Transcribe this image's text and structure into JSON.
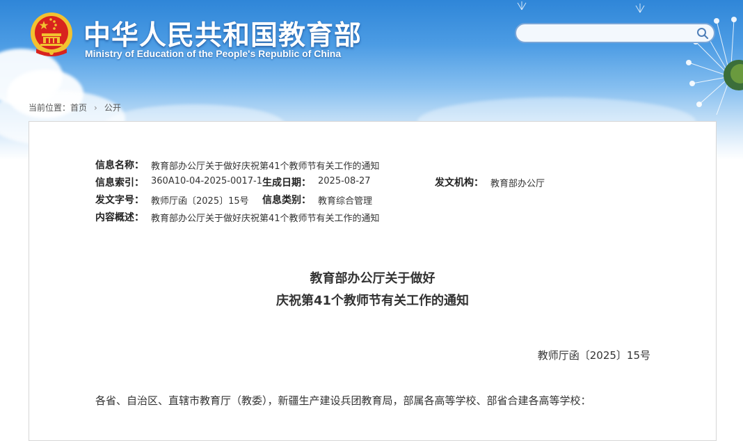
{
  "header": {
    "title": "中华人民共和国教育部",
    "subtitle": "Ministry of Education of the People's Republic of China",
    "emblem_icon": "national-emblem-icon"
  },
  "search": {
    "value": "",
    "placeholder": "",
    "button_icon": "search-icon"
  },
  "breadcrumb": {
    "prefix": "当前位置：",
    "items": [
      "首页",
      "公开"
    ],
    "separator": "›"
  },
  "meta": {
    "info_name_label": "信息名称：",
    "info_name_value": "教育部办公厅关于做好庆祝第41个教师节有关工作的通知",
    "index_label": "信息索引：",
    "index_value": "360A10-04-2025-0017-1",
    "date_label": "生成日期：",
    "date_value": "2025-08-27",
    "issuer_label": "发文机构：",
    "issuer_value": "教育部办公厅",
    "doc_no_label": "发文字号：",
    "doc_no_value": "教师厅函〔2025〕15号",
    "category_label": "信息类别：",
    "category_value": "教育综合管理",
    "summary_label": "内容概述：",
    "summary_value": "教育部办公厅关于做好庆祝第41个教师节有关工作的通知"
  },
  "document": {
    "title_line1": "教育部办公厅关于做好",
    "title_line2": "庆祝第41个教师节有关工作的通知",
    "number": "教师厅函〔2025〕15号",
    "salutation": "各省、自治区、直辖市教育厅（教委），新疆生产建设兵团教育局，部属各高等学校、部省合建各高等学校："
  },
  "colors": {
    "sky_top": "#2f86d8",
    "search_border": "#7aa6d8",
    "emblem_red": "#d8231e",
    "emblem_gold": "#f2c230"
  }
}
